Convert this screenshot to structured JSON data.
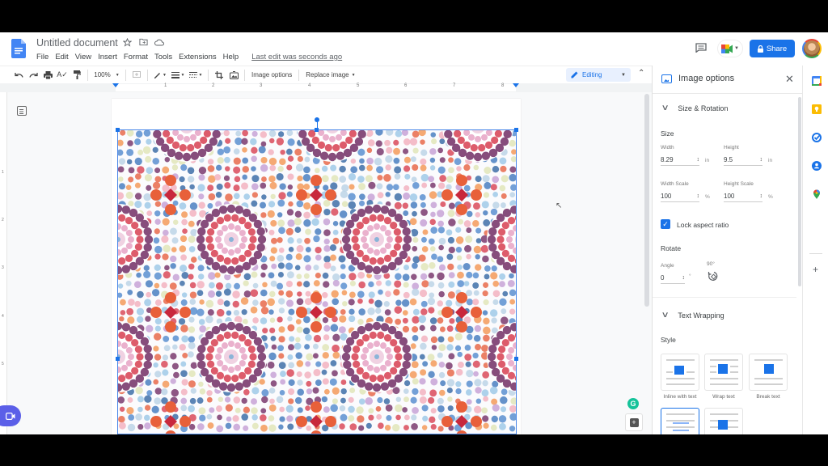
{
  "document": {
    "title": "Untitled document",
    "last_edit": "Last edit was seconds ago"
  },
  "menu": [
    "File",
    "Edit",
    "View",
    "Insert",
    "Format",
    "Tools",
    "Extensions",
    "Help"
  ],
  "header": {
    "share_label": "Share"
  },
  "toolbar": {
    "zoom": "100%",
    "image_options_label": "Image options",
    "replace_image_label": "Replace image",
    "mode_label": "Editing"
  },
  "ruler": {
    "numbers": [
      "1",
      "2",
      "3",
      "4",
      "5",
      "6",
      "7",
      "8"
    ],
    "vertical_numbers": [
      "1",
      "2",
      "3",
      "4",
      "5"
    ]
  },
  "image_options": {
    "title": "Image options",
    "size_rotation": {
      "heading": "Size & Rotation",
      "size_label": "Size",
      "width_label": "Width",
      "width_value": "8.29",
      "height_label": "Height",
      "height_value": "9.5",
      "unit_in": "in",
      "width_scale_label": "Width Scale",
      "width_scale_value": "100",
      "height_scale_label": "Height Scale",
      "height_scale_value": "100",
      "unit_pct": "%",
      "lock_aspect_label": "Lock aspect ratio",
      "lock_aspect_checked": true,
      "rotate_label": "Rotate",
      "angle_label": "Angle",
      "angle_value": "0",
      "unit_deg": "°",
      "rotate_90_label": "90°"
    },
    "text_wrapping": {
      "heading": "Text Wrapping",
      "style_label": "Style",
      "options": [
        "Inline with text",
        "Wrap text",
        "Break text"
      ],
      "selected_index": 3
    }
  },
  "colors": {
    "accent": "#1a73e8",
    "editing_bg": "#e8f0fe",
    "grammarly": "#15c39a",
    "meet_fab": "#5b5fe8"
  }
}
